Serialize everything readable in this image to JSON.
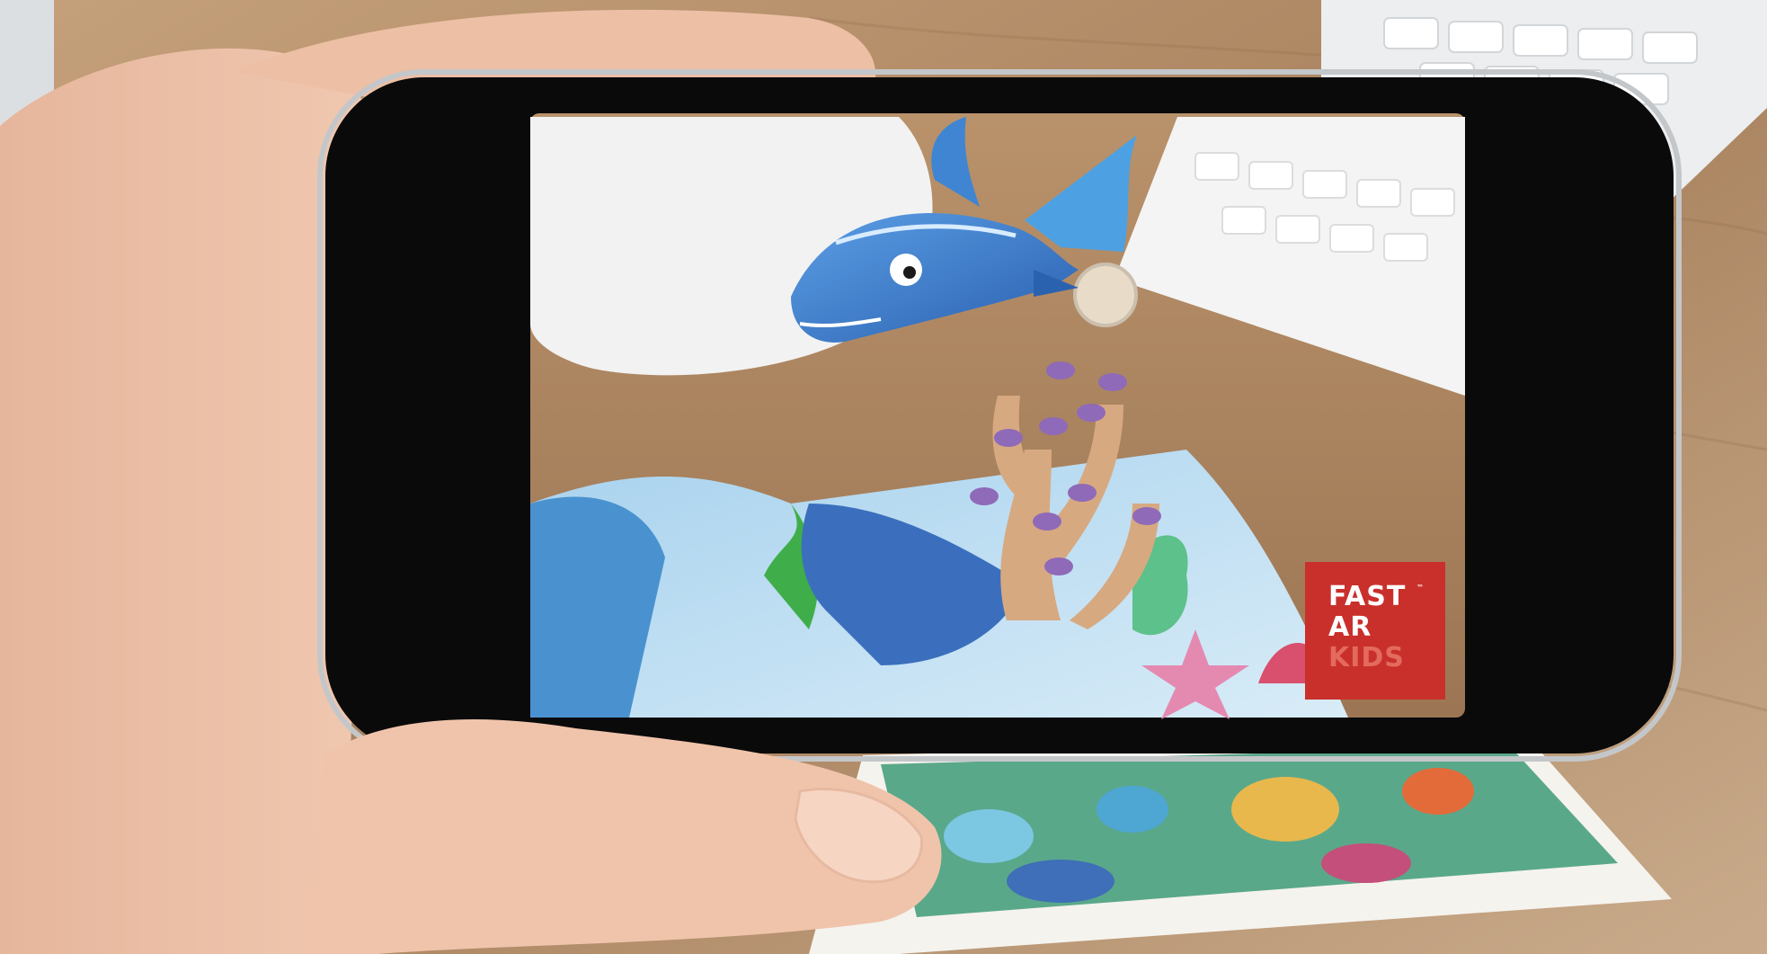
{
  "photo": {
    "subject": "hand-holding-phone-with-ar-fish-scene",
    "colors": {
      "background": "#dcdfe1",
      "desk": "#b58f6b",
      "phone_body": "#0a0a0a",
      "fish": "#3b7fd0",
      "coral": "#d7a981"
    }
  },
  "logo": {
    "line1": "FAST",
    "line2": "AR",
    "line3": "KIDS",
    "trademark": "™",
    "color": "#c9302c"
  }
}
